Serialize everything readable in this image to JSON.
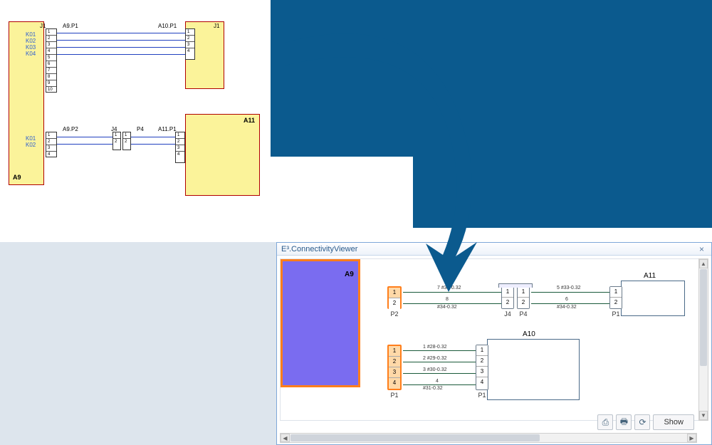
{
  "top": {
    "blocks": {
      "a9": "A9",
      "a10": "",
      "a11": "A11"
    },
    "ports": {
      "a9p1": "A9.P1",
      "a9p2": "A9.P2",
      "a10p1": "A10.P1",
      "a11p1": "A11.P1",
      "j4": "J4",
      "p4": "P4",
      "j1a": "J1",
      "j1b": "J1"
    },
    "signals": [
      "K01",
      "K02",
      "K03",
      "K04",
      "K01",
      "K02"
    ]
  },
  "arrow_color": "#0b5a8e",
  "viewer": {
    "title": "E³.ConnectivityViewer",
    "close": "×",
    "toolbar": {
      "export": "⎙",
      "print": "🖶",
      "refresh": "⟳",
      "show": "Show"
    },
    "blocks": {
      "a9": "A9",
      "a10": "A10",
      "a11": "A11",
      "j4": "J4",
      "p4": "P4"
    },
    "ports": {
      "p1": "P1",
      "p2": "P2"
    },
    "pins": [
      "1",
      "2",
      "3",
      "4"
    ],
    "wires_top": [
      {
        "n": "7",
        "c": "#33-0.32"
      },
      {
        "n": "8",
        "c": "#34-0.32"
      },
      {
        "n": "5",
        "c": "#33-0.32"
      },
      {
        "n": "6",
        "c": "#34-0.32"
      }
    ],
    "wires_bot": [
      {
        "n": "1",
        "c": "#28-0.32"
      },
      {
        "n": "2",
        "c": "#29-0.32"
      },
      {
        "n": "3",
        "c": "#30-0.32"
      },
      {
        "n": "4",
        "c": "#31-0.32"
      }
    ]
  }
}
